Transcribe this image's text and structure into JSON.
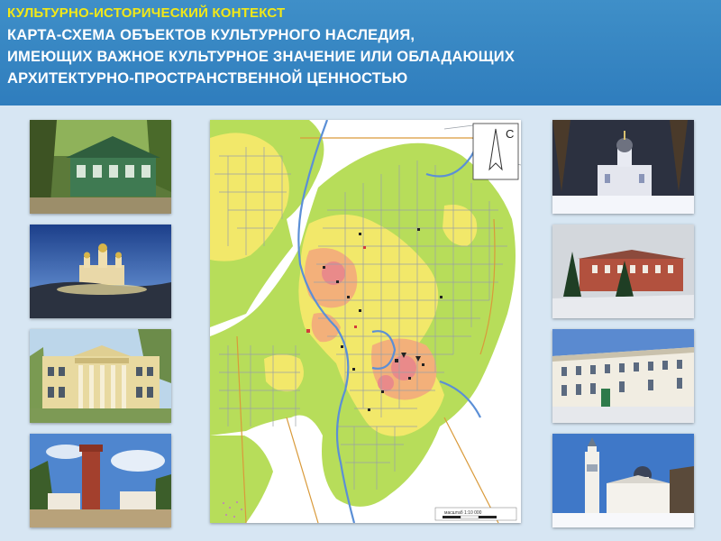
{
  "header": {
    "subtitle": "КУЛЬТУРНО-ИСТОРИЧЕСКИЙ КОНТЕКСТ",
    "title_lines": [
      "КАРТА-СХЕМА ОБЪЕКТОВ КУЛЬТУРНОГО НАСЛЕДИЯ,",
      "ИМЕЮЩИХ ВАЖНОЕ КУЛЬТУРНОЕ ЗНАЧЕНИЕ ИЛИ ОБЛАДАЮЩИХ",
      "АРХИТЕКТУРНО-ПРОСТРАНСТВЕННОЙ ЦЕННОСТЬЮ"
    ]
  },
  "map": {
    "north_letter": "С",
    "scale_text": "масштаб 1:10 000",
    "colors": {
      "low_value_zone": "#b7dd5a",
      "medium_value_zone": "#f2e86a",
      "high_value_zone": "#f3b07a",
      "core_zone": "#e98a8a",
      "river": "#5b8fd6",
      "roads": "#9aa0a8"
    }
  },
  "photos": {
    "left": [
      "wooden-green-house",
      "church-at-dusk",
      "classical-manor-house",
      "red-brick-water-tower"
    ],
    "right": [
      "church-in-snow-at-night",
      "red-brick-building-with-firs",
      "white-merchant-building",
      "white-church-with-bell-tower"
    ]
  }
}
